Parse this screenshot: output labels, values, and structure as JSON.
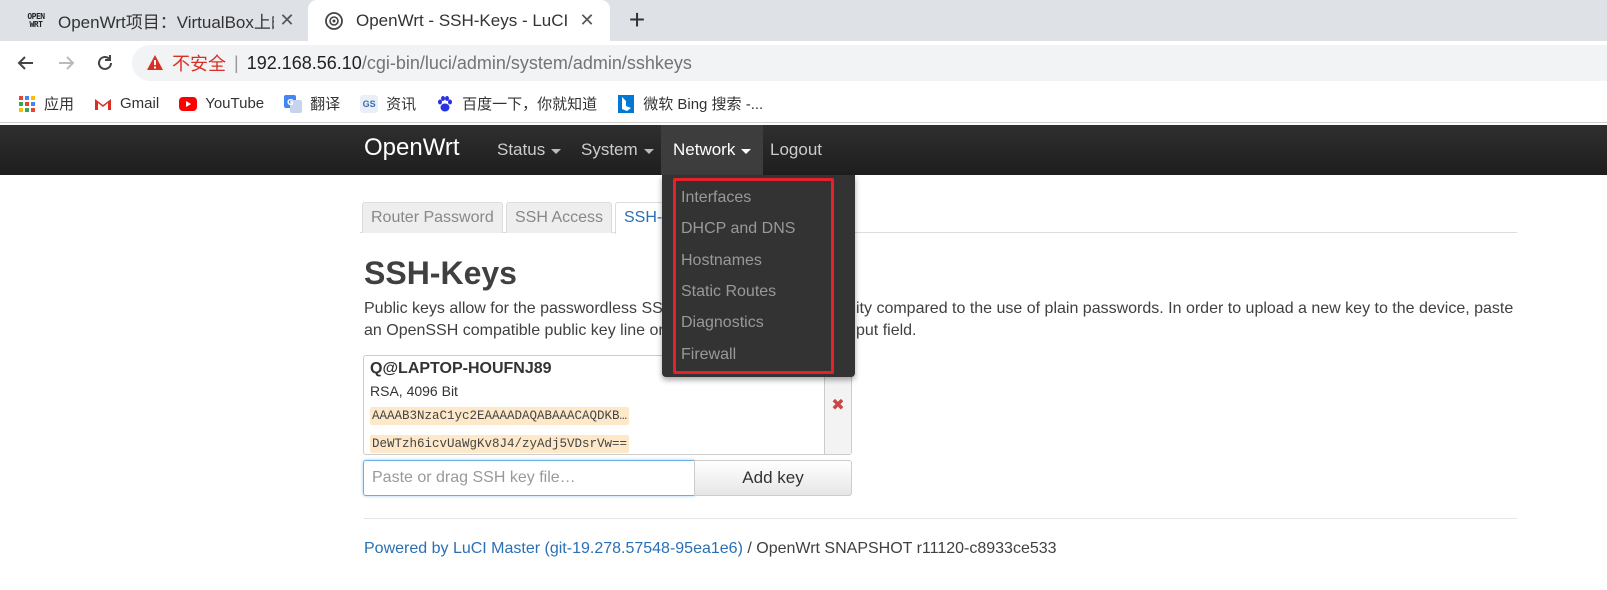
{
  "browser": {
    "tabs": [
      {
        "title": "OpenWrt项目：VirtualBox上的",
        "favicon": "openwrt-logo",
        "logo_text": [
          "OPEN",
          "WRT"
        ]
      },
      {
        "title": "OpenWrt - SSH-Keys - LuCI",
        "favicon": "luci-globe-icon"
      }
    ],
    "close_glyph": "✕",
    "new_tab_glyph": "+",
    "insecure_label": "不安全",
    "url_separator": "|",
    "url_host": "192.168.56.10",
    "url_path": "/cgi-bin/luci/admin/system/admin/sshkeys",
    "bookmarks": [
      {
        "label": "应用",
        "icon": "apps-grid-icon"
      },
      {
        "label": "Gmail",
        "icon": "gmail-icon"
      },
      {
        "label": "YouTube",
        "icon": "youtube-icon"
      },
      {
        "label": "翻译",
        "icon": "translate-icon"
      },
      {
        "label": "资讯",
        "icon": "news-icon",
        "icon_text": "GS"
      },
      {
        "label": "百度一下，你就知道",
        "icon": "baidu-icon"
      },
      {
        "label": "微软 Bing 搜索 -...",
        "icon": "bing-icon"
      }
    ]
  },
  "luci": {
    "brand": "OpenWrt",
    "menu": [
      {
        "label": "Status",
        "has_caret": true
      },
      {
        "label": "System",
        "has_caret": true
      },
      {
        "label": "Network",
        "has_caret": true,
        "open": true
      },
      {
        "label": "Logout",
        "has_caret": false
      }
    ],
    "network_dropdown": [
      "Interfaces",
      "DHCP and DNS",
      "Hostnames",
      "Static Routes",
      "Diagnostics",
      "Firewall"
    ],
    "subtabs": [
      "Router Password",
      "SSH Access",
      "SSH-Keys"
    ],
    "subtab_selected_visible": "SSH-",
    "page_title": "SSH-Keys",
    "description_line1": "Public keys allow for the passwordless SSH",
    "description_line1_right": "ity compared to the use of plain passwords. In order to upload a new key to the device, paste",
    "description_line2": "an OpenSSH compatible public key line or",
    "description_line2_right": "put field.",
    "key": {
      "name": "Q@LAPTOP-HOUFNJ89",
      "type": "RSA, 4096 Bit",
      "data_start": "AAAAB3NzaC1yc2EAAAADAQABAAACAQDKB…",
      "data_end": "DeWTzh6icvUaWgKv8J4/zyAdj5VDsrVw=="
    },
    "remove_glyph": "✖",
    "key_input_placeholder": "Paste or drag SSH key file…",
    "add_key_label": "Add key",
    "footer_link": "Powered by LuCI Master (git-19.278.57548-95ea1e6)",
    "footer_text": " / OpenWrt SNAPSHOT r11120-c8933ce533"
  },
  "colors": {
    "highlight_box": "#e8202a",
    "link": "#2a6fb5",
    "insecure": "#d93025"
  }
}
